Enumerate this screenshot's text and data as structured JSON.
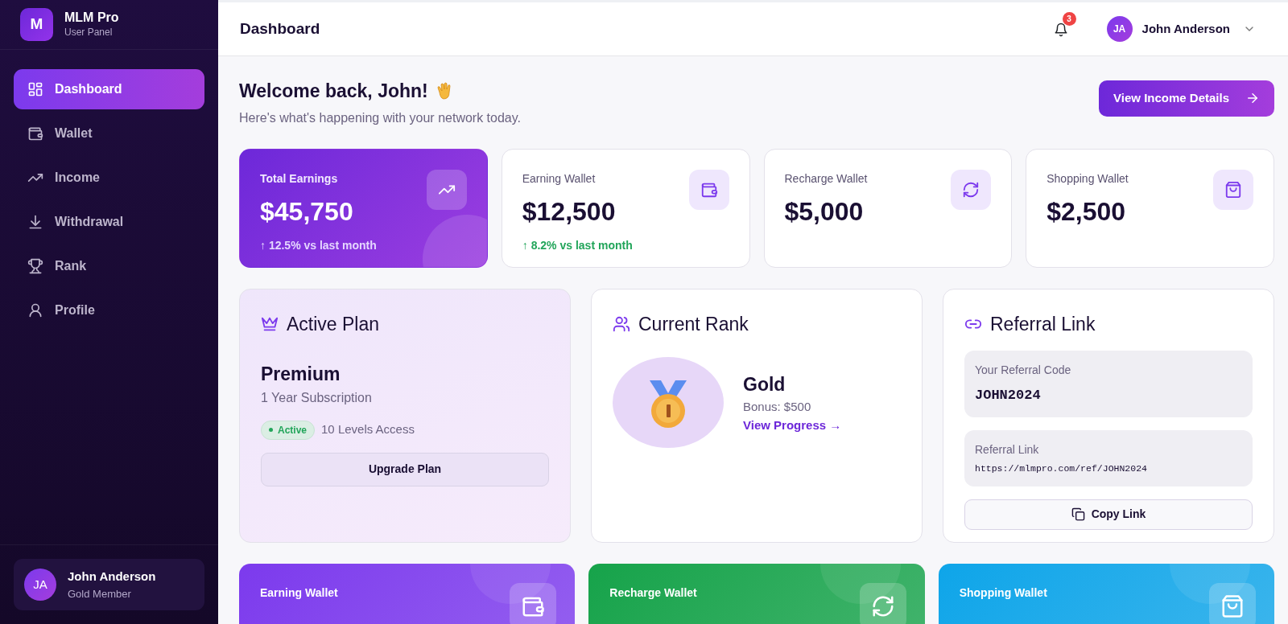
{
  "brand": {
    "logo": "M",
    "name": "MLM Pro",
    "subtitle": "User Panel"
  },
  "sidebar": {
    "items": [
      {
        "label": "Dashboard",
        "selected": true
      },
      {
        "label": "Wallet",
        "selected": false
      },
      {
        "label": "Income",
        "selected": false
      },
      {
        "label": "Withdrawal",
        "selected": false
      },
      {
        "label": "Rank",
        "selected": false
      },
      {
        "label": "Profile",
        "selected": false
      }
    ],
    "user_card": {
      "initials": "JA",
      "name": "John Anderson",
      "role": "Gold Member"
    }
  },
  "header": {
    "title": "Dashboard",
    "notification_count": "3",
    "user": {
      "initials": "JA",
      "name": "John Anderson"
    }
  },
  "welcome": {
    "title": "Welcome back, John!",
    "subtitle": "Here's what's happening with your network today.",
    "button": "View Income Details"
  },
  "stats": [
    {
      "kind": "highlight",
      "label": "Total Earnings",
      "value": "$45,750",
      "trend": "↑ **12.5%** vs last month"
    },
    {
      "kind": "plain",
      "label": "Earning Wallet",
      "value": "$12,500",
      "trend": "↑ **8.2%** vs last month"
    },
    {
      "kind": "plain",
      "label": "Recharge Wallet",
      "value": "$5,000"
    },
    {
      "kind": "plain",
      "label": "Shopping Wallet",
      "value": "$2,500"
    }
  ],
  "plan": {
    "title": "Active Plan",
    "name": "Premium",
    "duration": "1 Year Subscription",
    "status": "Active",
    "access": "10 Levels Access",
    "button": "Upgrade Plan"
  },
  "rank": {
    "title": "Current Rank",
    "name": "Gold",
    "bonus": "Bonus: $500",
    "link": "View Progress →"
  },
  "referral": {
    "title": "Referral Link",
    "code_label": "Your Referral Code",
    "code": "JOHN2024",
    "link_label": "Referral Link",
    "link": "https://mlmpro.com/ref/JOHN2024",
    "button": "Copy Link"
  },
  "wallets": [
    {
      "label": "Earning Wallet",
      "color": "#7c3aed"
    },
    {
      "label": "Recharge Wallet",
      "color": "#16a34a"
    },
    {
      "label": "Shopping Wallet",
      "color": "#0ea5e9"
    }
  ]
}
